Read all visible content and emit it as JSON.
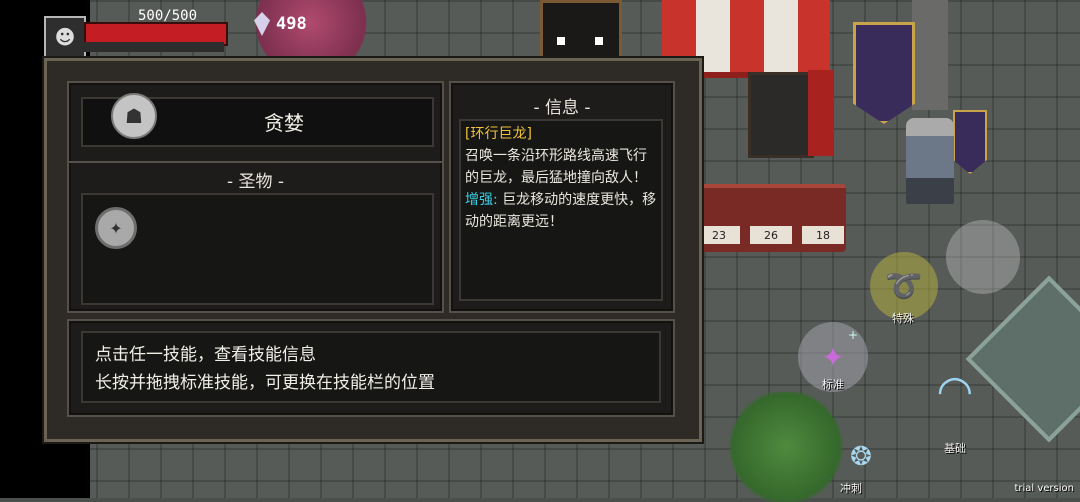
{
  "hud": {
    "hp_text": "500/500",
    "gem_count": "498"
  },
  "panel": {
    "skill_name": "贪婪",
    "relic_title": "- 圣物 -",
    "info_title": "- 信息 -",
    "info": {
      "skill_tag": "[环行巨龙]",
      "description": "召唤一条沿环形路线高速飞行的巨龙，最后猛地撞向敌人！",
      "enhance_label": "增强:",
      "enhance_text": "巨龙移动的速度更快，移动的距离更远！"
    },
    "tips": {
      "line1": "点击任一技能，查看技能信息",
      "line2": "长按并拖拽标准技能，可更换在技能栏的位置"
    }
  },
  "shop": {
    "prices": [
      "23",
      "26",
      "18"
    ]
  },
  "controls": {
    "special_label": "特殊",
    "standard_label": "标准",
    "basic_label": "基础",
    "dash_label": "冲刺"
  },
  "footer": {
    "trial": "trial version"
  },
  "colors": {
    "hp_bar": "#c41d24",
    "skill_tag": "#f0c23c",
    "enhance_label": "#39d0e6",
    "panel_bg": "#2e2b26"
  }
}
